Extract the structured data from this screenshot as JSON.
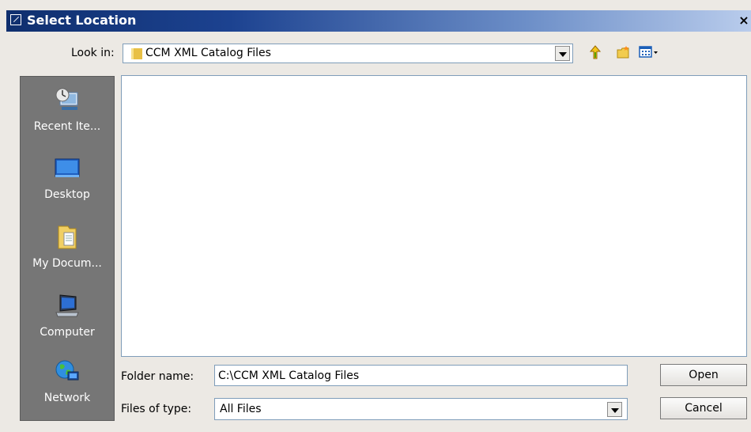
{
  "window": {
    "title": "Select Location",
    "close_glyph": "×",
    "title_icon": "dialog-icon"
  },
  "lookin": {
    "label": "Look in:",
    "value": "CCM XML Catalog Files",
    "folder_icon": "folder-icon"
  },
  "toolbar": {
    "icons": [
      "up-one-level-icon",
      "create-new-folder-icon",
      "view-menu-icon"
    ]
  },
  "places": {
    "items": [
      {
        "label": "Recent Ite...",
        "icon": "recent-items-icon"
      },
      {
        "label": "Desktop",
        "icon": "desktop-icon"
      },
      {
        "label": "My Docum...",
        "icon": "my-documents-icon"
      },
      {
        "label": "Computer",
        "icon": "computer-icon"
      },
      {
        "label": "Network",
        "icon": "network-icon"
      }
    ]
  },
  "file_list": {
    "items": []
  },
  "folder_name": {
    "label": "Folder name:",
    "value": "C:\\CCM XML Catalog Files"
  },
  "files_of_type": {
    "label": "Files of type:",
    "value": "All Files"
  },
  "buttons": {
    "open": "Open",
    "cancel": "Cancel"
  },
  "colors": {
    "title_bar_start": "#0f2f6e",
    "title_bar_end": "#b9ccec",
    "places_bar": "#767676",
    "dialog_bg": "#ece9e4"
  }
}
